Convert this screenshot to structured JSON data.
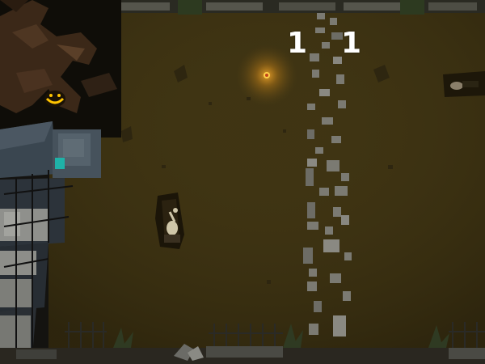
{
  "hud": {
    "score_left": "1",
    "score_right": "1"
  },
  "scene": {
    "setting": "graveyard",
    "colors": {
      "ground": "#3f3413",
      "path_stone": "#7b7a72",
      "torch_glow": "#ff9a1a",
      "house_roof": "#3a4650",
      "fence": "#2e2e2e",
      "tree": "#4a3020"
    }
  }
}
